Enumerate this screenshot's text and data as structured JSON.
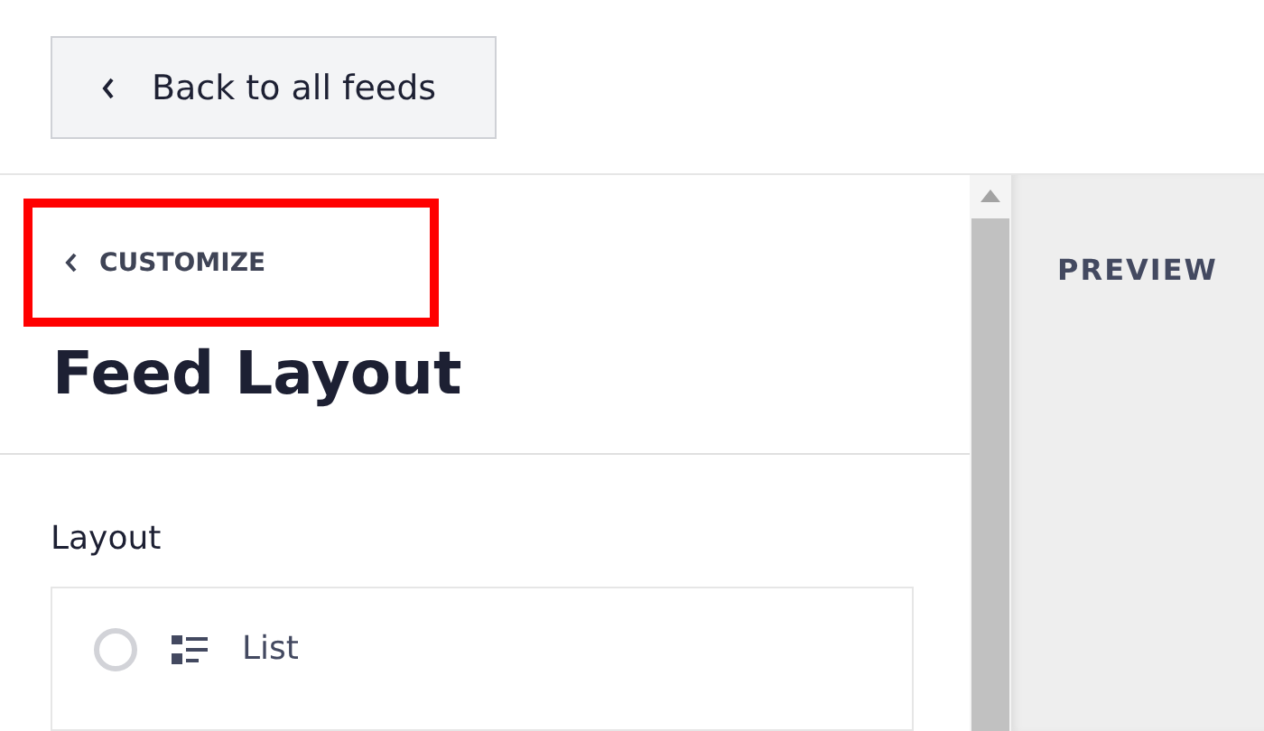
{
  "back_button": {
    "label": "Back to all feeds"
  },
  "breadcrumb": {
    "label": "CUSTOMIZE",
    "highlighted": true
  },
  "title": "Feed Layout",
  "section": {
    "label": "Layout",
    "options": [
      {
        "label": "List",
        "selected": false
      }
    ]
  },
  "preview": {
    "label": "PREVIEW"
  }
}
